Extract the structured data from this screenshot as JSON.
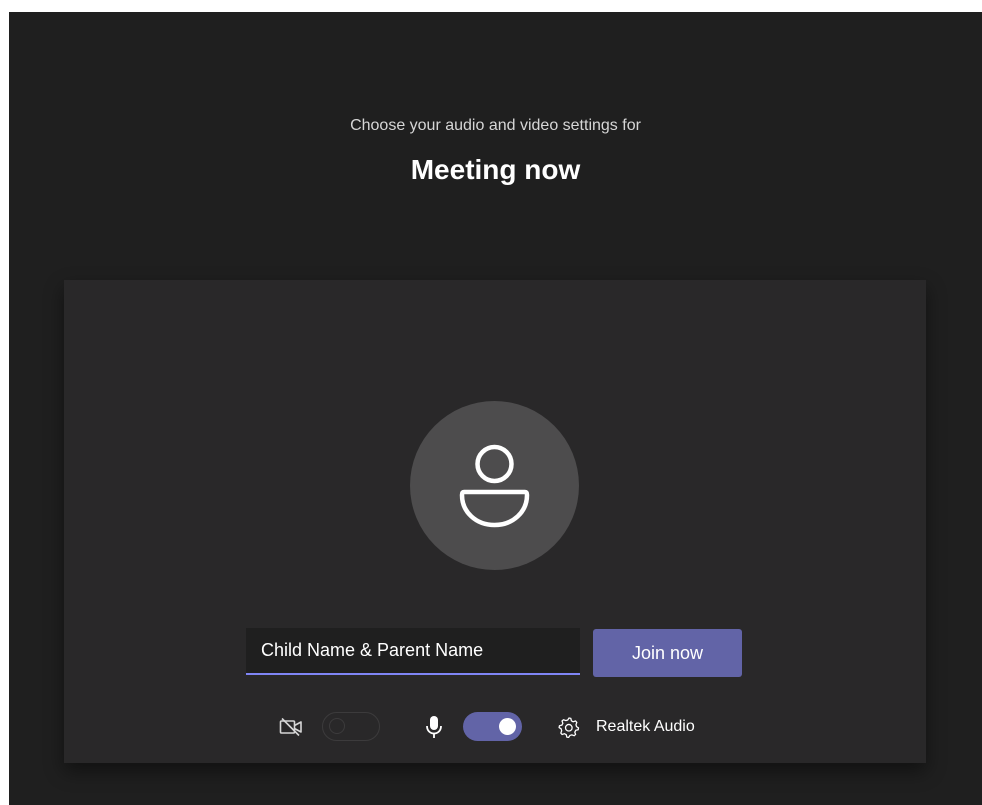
{
  "header": {
    "subtitle": "Choose your audio and video settings for",
    "meeting_title": "Meeting now"
  },
  "preview": {
    "avatar_icon": "person-icon"
  },
  "join_form": {
    "name_value": "Child Name & Parent Name",
    "join_label": "Join now"
  },
  "controls": {
    "camera_icon": "camera-off-icon",
    "camera_on": false,
    "mic_icon": "microphone-icon",
    "mic_on": true,
    "settings_icon": "gear-icon",
    "audio_device_label": "Realtek Audio"
  },
  "colors": {
    "background": "#1f1f1f",
    "panel": "#292829",
    "avatar": "#4d4c4d",
    "accent": "#6264a7",
    "input_underline": "#7f85f5"
  }
}
